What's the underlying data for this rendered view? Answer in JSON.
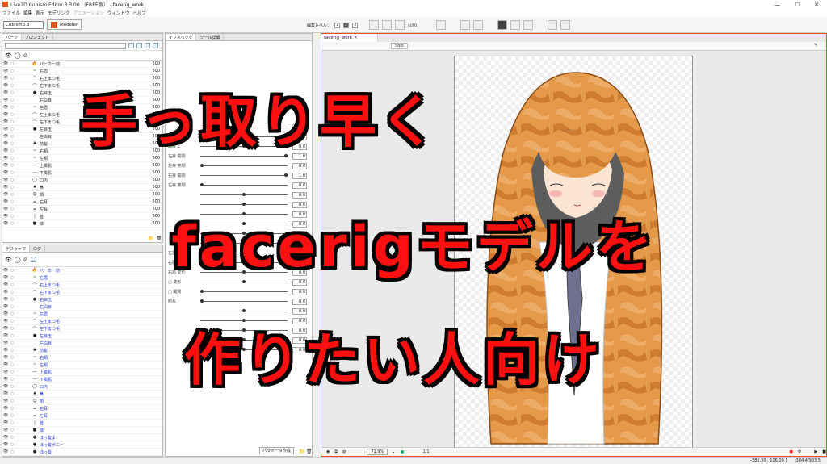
{
  "window": {
    "title": "Live2D Cubism Editor 3.3.00 ［FREE版］ - facerig_work"
  },
  "menu": [
    "ファイル",
    "編集",
    "表示",
    "モデリング",
    "アニメーション",
    "ウィンドウ",
    "ヘルプ"
  ],
  "toolbar": {
    "profile": "Cubism3.3",
    "modeler_label": "Modeler",
    "edit_level_label": "編集レベル：",
    "levels": [
      "1",
      "2",
      "3"
    ],
    "auto_label": "AUTO"
  },
  "parts_panel": {
    "tabs": [
      "パーツ",
      "プロジェクト"
    ],
    "rows": [
      {
        "icon": "🔥",
        "label": "パーカー前",
        "num": "500"
      },
      {
        "icon": "~",
        "label": "右眉",
        "num": "500"
      },
      {
        "icon": "⌒",
        "label": "右上まつ毛",
        "num": "500"
      },
      {
        "icon": "⌒",
        "label": "右下まつ毛",
        "num": "500"
      },
      {
        "icon": "●",
        "label": "右目玉",
        "num": "500"
      },
      {
        "icon": "",
        "label": "右白目",
        "num": "500"
      },
      {
        "icon": "~",
        "label": "左眉",
        "num": "500"
      },
      {
        "icon": "⌒",
        "label": "左上まつ毛",
        "num": "500"
      },
      {
        "icon": "⌒",
        "label": "左下まつ毛",
        "num": "500"
      },
      {
        "icon": "●",
        "label": "左目玉",
        "num": "500"
      },
      {
        "icon": "",
        "label": "左白目",
        "num": "500"
      },
      {
        "icon": "♣",
        "label": "前髪",
        "num": "500"
      },
      {
        "icon": "~",
        "label": "右頬",
        "num": "500"
      },
      {
        "icon": "~",
        "label": "左頬",
        "num": "500"
      },
      {
        "icon": "—",
        "label": "上瞼肌",
        "num": "500"
      },
      {
        "icon": "—",
        "label": "下瞼肌",
        "num": "500"
      },
      {
        "icon": "◯",
        "label": "口内",
        "num": "500"
      },
      {
        "icon": "♦",
        "label": "鼻",
        "num": "500"
      },
      {
        "icon": "☺",
        "label": "顔",
        "num": "500"
      },
      {
        "icon": "⌓",
        "label": "右耳",
        "num": "500"
      },
      {
        "icon": "⌓",
        "label": "左耳",
        "num": "500"
      },
      {
        "icon": "|",
        "label": "首",
        "num": "500"
      },
      {
        "icon": "■",
        "label": "体",
        "num": "500"
      }
    ]
  },
  "deformer_panel": {
    "tabs": [
      "デフォーマ",
      "ログ"
    ],
    "rows": [
      {
        "icon": "🔥",
        "label": "パーカー前"
      },
      {
        "icon": "~",
        "label": "右眉"
      },
      {
        "icon": "⌒",
        "label": "右上まつ毛"
      },
      {
        "icon": "⌒",
        "label": "右下まつ毛"
      },
      {
        "icon": "●",
        "label": "右目玉"
      },
      {
        "icon": "",
        "label": "右白目"
      },
      {
        "icon": "~",
        "label": "左眉"
      },
      {
        "icon": "⌒",
        "label": "左上まつ毛"
      },
      {
        "icon": "⌒",
        "label": "左下まつ毛"
      },
      {
        "icon": "●",
        "label": "左目玉"
      },
      {
        "icon": "",
        "label": "左白目"
      },
      {
        "icon": "♣",
        "label": "前髪"
      },
      {
        "icon": "~",
        "label": "右頬"
      },
      {
        "icon": "~",
        "label": "左頬"
      },
      {
        "icon": "—",
        "label": "上瞼肌"
      },
      {
        "icon": "—",
        "label": "下瞼肌"
      },
      {
        "icon": "◯",
        "label": "口内"
      },
      {
        "icon": "♦",
        "label": "鼻"
      },
      {
        "icon": "☺",
        "label": "顔"
      },
      {
        "icon": "⌓",
        "label": "右耳"
      },
      {
        "icon": "⌓",
        "label": "左耳"
      },
      {
        "icon": "|",
        "label": "首"
      },
      {
        "icon": "■",
        "label": "体"
      },
      {
        "icon": "●",
        "label": "ほっ髪よ"
      },
      {
        "icon": "●",
        "label": "ほっ髪ポニー"
      },
      {
        "icon": "●",
        "label": "ほっ髪"
      }
    ]
  },
  "inspector": {
    "tabs": [
      "インスペクタ",
      "ツール詳細"
    ],
    "params": [
      {
        "label": "",
        "value": "0.0",
        "knob": 0.5
      },
      {
        "label": "",
        "value": "0.0",
        "knob": 0.5
      },
      {
        "label": "角度 Z",
        "value": "0.0",
        "knob": 0.5
      },
      {
        "label": "左目 開閉",
        "value": "1.0",
        "knob": 1.0
      },
      {
        "label": "左目 笑顔",
        "value": "0.0",
        "knob": 0.0
      },
      {
        "label": "右目 開閉",
        "value": "1.0",
        "knob": 1.0
      },
      {
        "label": "右目 笑顔",
        "value": "0.0",
        "knob": 0.0
      },
      {
        "label": "",
        "value": "0.0",
        "knob": 0.5
      },
      {
        "label": "",
        "value": "0.0",
        "knob": 0.5
      },
      {
        "label": "",
        "value": "0.0",
        "knob": 0.5
      },
      {
        "label": "",
        "value": "0.0",
        "knob": 0.5
      },
      {
        "label": "",
        "value": "0.0",
        "knob": 0.5
      },
      {
        "label": "",
        "value": "0.0",
        "knob": 0.5
      },
      {
        "label": "右眉 角度",
        "value": "0.0",
        "knob": 0.5
      },
      {
        "label": "右眉 変形",
        "value": "0.0",
        "knob": 0.5
      },
      {
        "label": "右眉 変形",
        "value": "0.0",
        "knob": 0.5
      },
      {
        "label": "□ 変形",
        "value": "0.0",
        "knob": 0.5
      },
      {
        "label": "□ 開閉",
        "value": "0.0",
        "knob": 0.0
      },
      {
        "label": "照れ",
        "value": "0.0",
        "knob": 0.0
      },
      {
        "label": "",
        "value": "0.0",
        "knob": 0.5
      },
      {
        "label": "",
        "value": "0.0",
        "knob": 0.5
      },
      {
        "label": "",
        "value": "0.0",
        "knob": 0.5
      },
      {
        "label": "",
        "value": "0.0",
        "knob": 0.5
      },
      {
        "label": "",
        "value": "0.0",
        "knob": 0.5
      }
    ],
    "bottom_button": "パラメータ作成"
  },
  "viewer": {
    "tab": "facerig_work",
    "solo": "Solo",
    "zoom": "71.9%",
    "page": "1/1"
  },
  "status": {
    "coords": "-385.30 , 106.09 ]",
    "coords2": "-384.4/933.5"
  },
  "overlay": {
    "line1": "手っ取り早く",
    "line2": "facerigモデルを",
    "line3": "作りたい人向け"
  },
  "colors": {
    "accent": "#e2561e",
    "overlay_text": "#ff1010",
    "blue_label": "#1a33d6"
  }
}
